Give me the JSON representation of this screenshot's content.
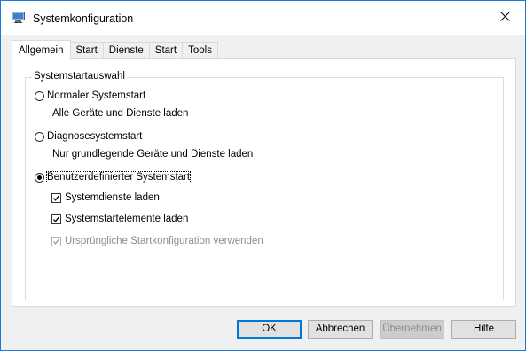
{
  "window": {
    "title": "Systemkonfiguration",
    "icon": "msconfig-icon",
    "accent_color": "#0078d7"
  },
  "tabs": [
    {
      "label": "Allgemein",
      "active": true
    },
    {
      "label": "Start",
      "active": false
    },
    {
      "label": "Dienste",
      "active": false
    },
    {
      "label": "Start",
      "active": false
    },
    {
      "label": "Tools",
      "active": false
    }
  ],
  "startup_selection": {
    "legend": "Systemstartauswahl",
    "options": [
      {
        "label": "Normaler Systemstart",
        "description": "Alle Geräte und Dienste laden",
        "selected": false
      },
      {
        "label": "Diagnosesystemstart",
        "description": "Nur grundlegende Geräte und Dienste laden",
        "selected": false
      },
      {
        "label": "Benutzerdefinierter Systemstart",
        "selected": true
      }
    ],
    "checks": [
      {
        "label": "Systemdienste laden",
        "checked": true,
        "disabled": false
      },
      {
        "label": "Systemstartelemente laden",
        "checked": true,
        "disabled": false
      },
      {
        "label": "Ursprüngliche Startkonfiguration verwenden",
        "checked": true,
        "disabled": true
      }
    ]
  },
  "buttons": {
    "ok": "OK",
    "cancel": "Abbrechen",
    "apply": "Übernehmen",
    "help": "Hilfe"
  }
}
